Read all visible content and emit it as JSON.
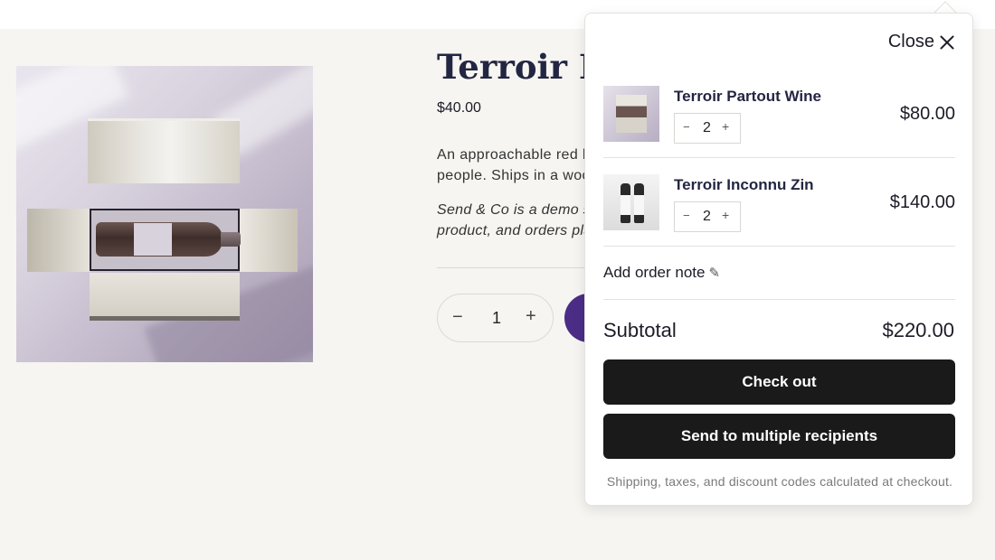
{
  "product": {
    "title": "Terroir Partout Wine",
    "price": "$40.00",
    "description_lines": [
      "An approachable red blend",
      "people. Ships in a wooden"
    ],
    "note_lines": [
      "Send & Co is a demo store",
      "product, and orders placed"
    ],
    "quantity": "1",
    "qty_minus": "−",
    "qty_plus": "+"
  },
  "cart": {
    "close_label": "Close",
    "items": [
      {
        "name": "Terroir Partout Wine",
        "quantity": "2",
        "price": "$80.00",
        "minus": "−",
        "plus": "+"
      },
      {
        "name": "Terroir Inconnu Zin",
        "quantity": "2",
        "price": "$140.00",
        "minus": "−",
        "plus": "+"
      }
    ],
    "order_note_label": "Add order note",
    "subtotal_label": "Subtotal",
    "subtotal_value": "$220.00",
    "checkout_label": "Check out",
    "multi_label": "Send to multiple recipients",
    "fine_print": "Shipping, taxes, and discount codes calculated at checkout."
  },
  "colors": {
    "page_bg": "#f6f5f1",
    "title_navy": "#232642",
    "accent_purple": "#4b2d86",
    "button_black": "#1a1a1a"
  },
  "icons": [
    "close-icon",
    "pencil-icon",
    "minus-icon",
    "plus-icon"
  ]
}
